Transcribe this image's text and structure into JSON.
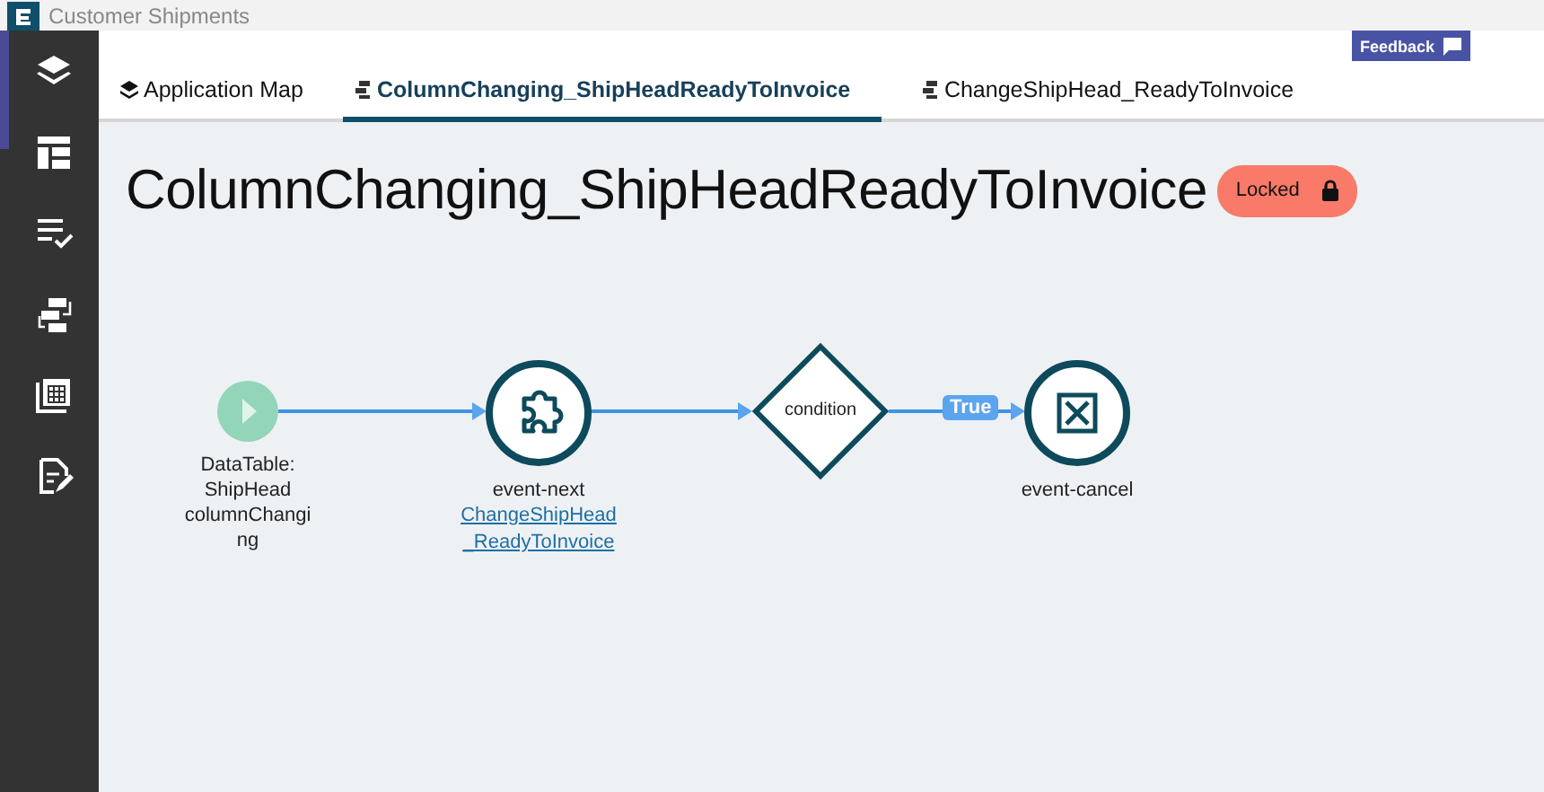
{
  "window": {
    "title": "Customer Shipments"
  },
  "feedback": {
    "label": "Feedback"
  },
  "sidebar": {
    "items": [
      {
        "kind": "layers"
      },
      {
        "kind": "layout"
      },
      {
        "kind": "checklist"
      },
      {
        "kind": "flow"
      },
      {
        "kind": "grid"
      },
      {
        "kind": "edit"
      }
    ]
  },
  "tabs": [
    {
      "label": "Application Map",
      "kind": "map",
      "selected": false
    },
    {
      "label": "ColumnChanging_ShipHeadReadyToInvoice",
      "kind": "directive",
      "selected": true
    },
    {
      "label": "ChangeShipHead_ReadyToInvoice",
      "kind": "directive",
      "selected": false
    }
  ],
  "heading": {
    "title": "ColumnChanging_ShipHeadReadyToInvoice",
    "badge": "Locked",
    "locked": true
  },
  "diagram": {
    "nodes": [
      {
        "kind": "start",
        "label": "DataTable: ShipHead columnChanging"
      },
      {
        "kind": "event-next",
        "label": "event-next",
        "link": "ChangeShipHead_ReadyToInvoice"
      },
      {
        "kind": "condition",
        "label": "condition",
        "out_label": "True"
      },
      {
        "kind": "event-cancel",
        "label": "event-cancel"
      }
    ]
  }
}
